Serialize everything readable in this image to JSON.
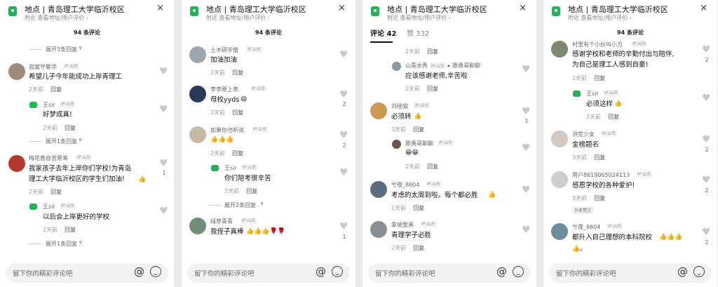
{
  "common": {
    "location_label": "地点",
    "location_name": "青岛理工大学临沂校区",
    "location_sub": "附近  查看地址/用户评价 ›",
    "close": "×",
    "comment_count": "94 条评论",
    "input_placeholder": "留下你的精彩评论吧",
    "at": "@",
    "time_2d": "2天前",
    "time_1d": "1天前",
    "time_3d": "3天前",
    "reply": "回复",
    "ip": "IP:山东",
    "author_tag": "作者赞过"
  },
  "tabs": {
    "comments": "评论 42",
    "likes": "赞 332"
  },
  "p1": {
    "more_top": "展开3条回复",
    "c1": {
      "name": "寂寞守繁华",
      "text": "希望儿子今年能成功上岸青理工"
    },
    "r1": {
      "name": "王sir",
      "text": "好梦成真!"
    },
    "more_1": "展开1条回复",
    "c2": {
      "name": "梅花香自苦寒来",
      "text1": "我家孩子去年上岸你们学校!为青岛",
      "text2": "理工大学临沂校区的学生们加油!",
      "likes": "1"
    },
    "r2": {
      "name": "王sir",
      "text": "以后会上岸更好的学校"
    },
    "more_2": "展开1条回复"
  },
  "p2": {
    "c1": {
      "name": "土木研学僧",
      "text": "加油加油"
    },
    "c2": {
      "name": "李李原上草.",
      "text": "母校yyds",
      "likes": "2"
    },
    "c3": {
      "name": "如果你也听说",
      "likes": "2"
    },
    "r3": {
      "name": "王sir",
      "text": "你们陪考很辛苦"
    },
    "more": "展开2条回复",
    "c4": {
      "name": "绿草青青",
      "text": "我侄子真棒",
      "likes": "1"
    }
  },
  "p3": {
    "r0": {
      "name": "山青水秀",
      "arrow": "▸",
      "target": "跟勇哥聊聊",
      "text": "应该感谢老师,辛苦啦"
    },
    "c1": {
      "name": "刘晓猫",
      "text": "必须转",
      "likes": "1"
    },
    "r1": {
      "name": "跟勇哥聊聊"
    },
    "c2": {
      "name": "兮夜_8604",
      "text": "考虑的太周到啦。每个都必胜"
    },
    "c3": {
      "name": "拿坡里黑",
      "text": "青理学子必胜"
    }
  },
  "p4": {
    "c1": {
      "name": "村里有个小伙叫小方",
      "text1": "感谢学校和老师的辛勤付出与陪伴,",
      "text2": "为自己是理工人感到自豪!",
      "likes": "2"
    },
    "r1": {
      "name": "王sir",
      "text": "必须这样"
    },
    "c2": {
      "name": "洪荒少女",
      "text": "金榜题名",
      "likes": "2"
    },
    "c3": {
      "name": "用户8619065024113",
      "text": "感恩学校的各种爱护!",
      "likes": "2"
    },
    "c4": {
      "name": "兮夜_8604",
      "text": "都升入自己理想的本科院校",
      "likes": "2"
    }
  }
}
